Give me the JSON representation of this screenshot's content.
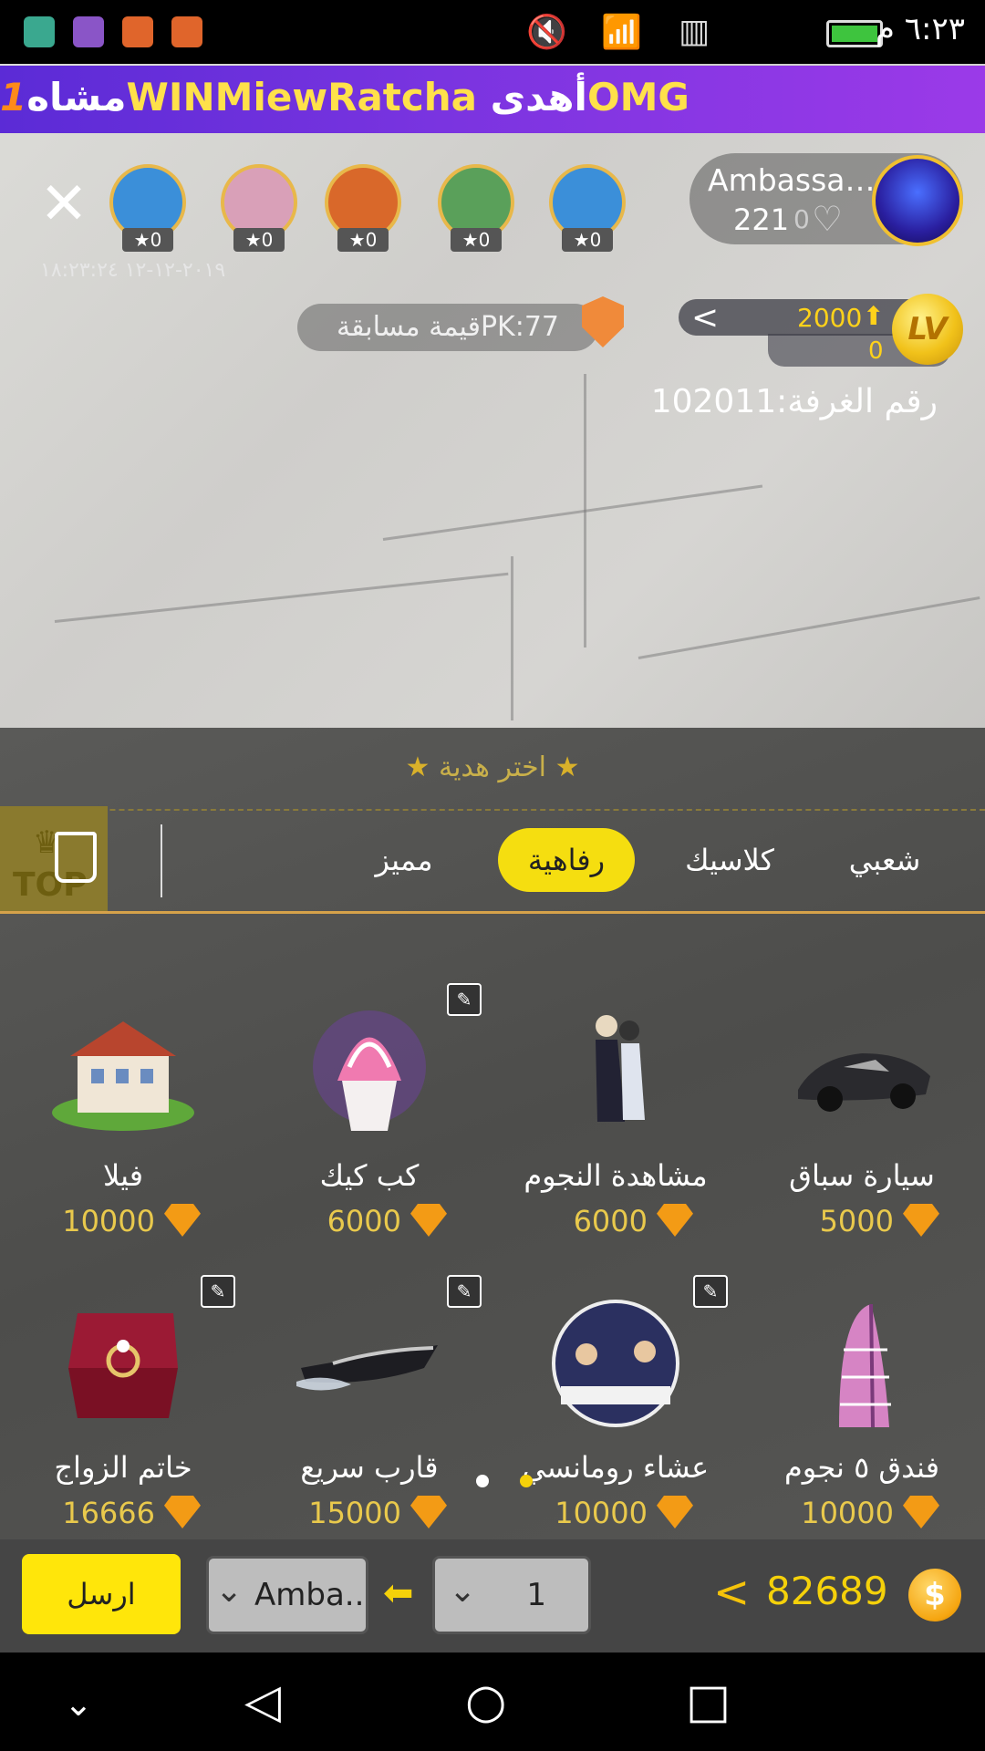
{
  "status_bar": {
    "time": "٦:٢٣ م",
    "app_icons": [
      {
        "name": "android-app-icon",
        "color": "#3aa88f"
      },
      {
        "name": "gallery-app-icon",
        "color": "#8a55c7"
      },
      {
        "name": "music-app-icon",
        "color": "#e0652b"
      },
      {
        "name": "music-app-icon-2",
        "color": "#e0652b"
      }
    ]
  },
  "banner": {
    "text_start": "مشاه",
    "rank": "1",
    "winner": "WINMiewRatcha",
    "gift_word": "أهدى",
    "gift_name": "OMG"
  },
  "host": {
    "name": "Ambassad...",
    "audience_count": "221",
    "likes": "0"
  },
  "viewers": [
    {
      "badge": "0",
      "color": "#3b8fd9"
    },
    {
      "badge": "0",
      "color": "#d9a0b8"
    },
    {
      "badge": "0",
      "color": "#d9682a"
    },
    {
      "badge": "0",
      "color": "#5aa05a"
    },
    {
      "badge": "0",
      "color": "#3b8fd9"
    }
  ],
  "timestamp": "٢٠١٩-١٢-١٢ ١٨:٢٣:٢٤",
  "pk": {
    "label": "قيمة مسابقةPK:77"
  },
  "level": {
    "value": "2000",
    "sub_value": "0",
    "coin_label": "LV"
  },
  "room": {
    "label": "رقم الغرفة:102011"
  },
  "gift_panel": {
    "title": "اختر هدية",
    "top_label": "TOP",
    "tabs": [
      {
        "label": "شعبي",
        "active": false
      },
      {
        "label": "كلاسيك",
        "active": false
      },
      {
        "label": "رفاهية",
        "active": true
      },
      {
        "label": "مميز",
        "active": false
      }
    ],
    "gifts": [
      {
        "name": "سيارة سباق",
        "price": "5000",
        "icon": "race-car-icon",
        "tagged": false
      },
      {
        "name": "مشاهدة النجوم",
        "price": "6000",
        "icon": "stargazing-couple-icon",
        "tagged": false
      },
      {
        "name": "كب كيك",
        "price": "6000",
        "icon": "cupcake-icon",
        "tagged": true
      },
      {
        "name": "فيلا",
        "price": "10000",
        "icon": "villa-icon",
        "tagged": false
      },
      {
        "name": "فندق ٥ نجوم",
        "price": "10000",
        "icon": "hotel-icon",
        "tagged": false
      },
      {
        "name": "عشاء رومانسي",
        "price": "10000",
        "icon": "romantic-dinner-icon",
        "tagged": true
      },
      {
        "name": "قارب سريع",
        "price": "15000",
        "icon": "speedboat-icon",
        "tagged": true
      },
      {
        "name": "خاتم الزواج",
        "price": "16666",
        "icon": "wedding-ring-icon",
        "tagged": true
      }
    ]
  },
  "bottom_bar": {
    "send_label": "ارسل",
    "recipient": "Amba...",
    "quantity": "1",
    "balance": "82689",
    "coin_symbol": "$"
  },
  "colors": {
    "accent_yellow": "#f5de10",
    "gift_price": "#e9c94c",
    "banner_purple": "#7a34e0"
  }
}
